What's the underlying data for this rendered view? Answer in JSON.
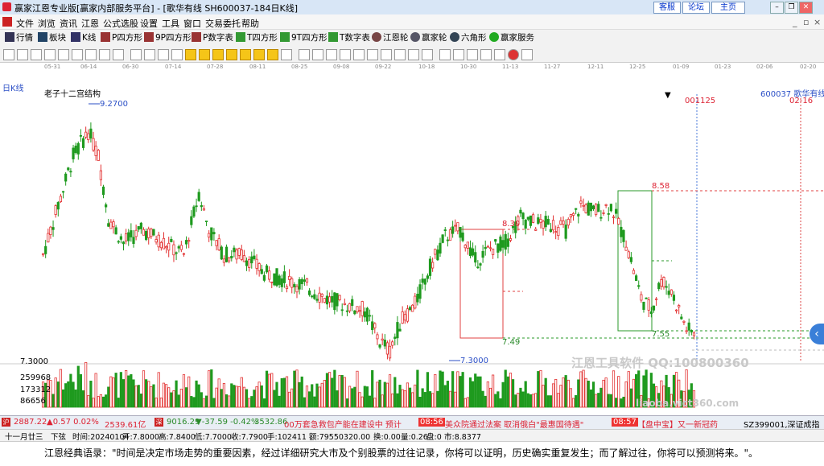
{
  "window": {
    "title": "赢家江恩专业版[赢家内部服务平台] - [歌华有线  SH600037-184日K线]",
    "buttons": [
      "客服",
      "论坛",
      "主页"
    ],
    "controls": [
      "minimize",
      "restore",
      "close"
    ]
  },
  "menu": [
    "文件",
    "浏览",
    "资讯",
    "江恩",
    "公式选股",
    "设置",
    "工具",
    "窗口",
    "交易委托",
    "帮助"
  ],
  "toolbar": [
    {
      "label": "行情",
      "icon": "grid-icon"
    },
    {
      "label": "板块",
      "icon": "blocks-icon"
    },
    {
      "label": "K线",
      "icon": "kline-icon"
    },
    {
      "label": "P四方形",
      "icon": "square-icon"
    },
    {
      "label": "9P四方形",
      "icon": "square-icon"
    },
    {
      "label": "P数字表",
      "icon": "table-icon"
    },
    {
      "label": "T四方形",
      "icon": "square-icon"
    },
    {
      "label": "9T四方形",
      "icon": "square-icon"
    },
    {
      "label": "T数字表",
      "icon": "table-icon"
    },
    {
      "label": "江恩轮",
      "icon": "wheel-icon"
    },
    {
      "label": "赢家轮",
      "icon": "wheel-icon"
    },
    {
      "label": "六角形",
      "icon": "hexagon-icon"
    },
    {
      "label": "赢家服务",
      "icon": "dollar-icon"
    }
  ],
  "dates": [
    "05-31",
    "06-14",
    "06-30",
    "07-14",
    "07-28",
    "08-11",
    "08-25",
    "09-08",
    "09-22",
    "10-18",
    "10-30",
    "11-13",
    "11-27",
    "12-11",
    "12-25",
    "01-09",
    "01-23",
    "02-06",
    "02-20"
  ],
  "chart_header": {
    "period": "日K线",
    "indicator": "老子十二宫结构",
    "stock": "600037  歌华有线",
    "date_mark_right": "02-16",
    "date_mark_mid": "001125"
  },
  "annotations": {
    "high": "9.2700",
    "low": "7.3000",
    "left_box_top": "8.30",
    "left_box_bottom": "7.49",
    "right_box_top": "8.58",
    "right_box_bottom": "7.55",
    "volume_axis": [
      "259968",
      "173312",
      "86656"
    ],
    "price_left_low": "7.3000"
  },
  "watermarks": [
    "江恩工具软件   QQ:100800360",
    "liaoba.vict360.com"
  ],
  "ticker": {
    "sh_index": "2887.22",
    "sh_change": "▲0.57  0.02%",
    "sh_amount": "2539.61亿",
    "sz_index": "9016.29",
    "sz_change": "▼-37.59  -0.42%",
    "sz_amount": "3532.86",
    "news": "00万套急救包产能在建设中 预计",
    "time1": "08:56",
    "news2": "美众院通过法案 取消俄白\"最惠国待遇\"",
    "time2": "08:57",
    "news3": "【盘中宝】又一新冠药",
    "code": "SZ399001,深证成指"
  },
  "status": {
    "lunar": "十一月廿三",
    "label": "下弦",
    "time": "时间:20240104",
    "open": "开:7.8000",
    "high": "高:7.8400",
    "low": "低:7.7000",
    "close": "收:7.7900",
    "hand": "手:102411",
    "amount": "额:79550320.00",
    "turnover": "换:0.00",
    "vol_ratio": "量:0.26",
    "pe": "盘:0",
    "k": "市:8.8377"
  },
  "quote": "江恩经典语录：\"时间是决定市场走势的重要因素，经过详细研究大市及个别股票的过往记录，你将可以证明，历史确实重复发生；而了解过往，你将可以预测将来。\"。",
  "colors": {
    "up": "#e23030",
    "down": "#1e9a1e",
    "box_up": "#e04040",
    "box_down": "#2a9a2a",
    "line": "#2b4fc6"
  }
}
